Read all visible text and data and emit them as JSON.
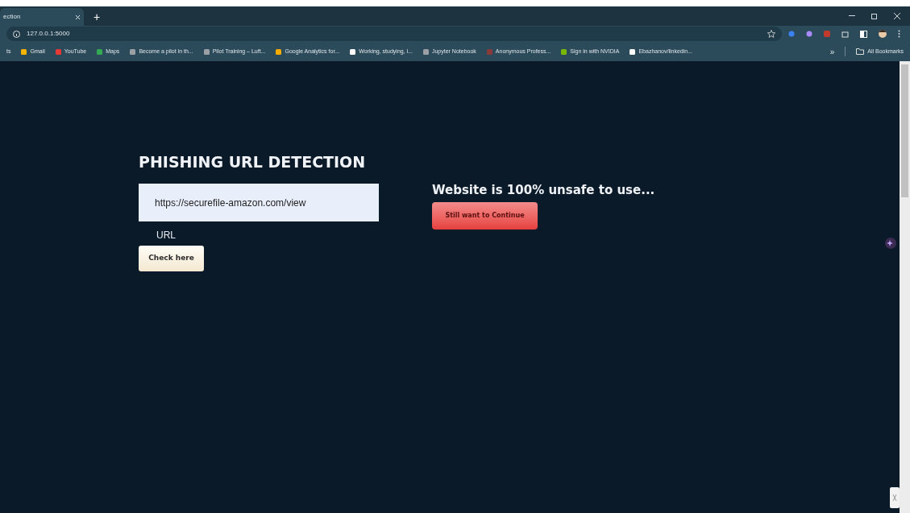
{
  "browser": {
    "tabs": [
      {
        "title": "ection",
        "selected": true
      }
    ],
    "address": "127.0.0.1:5000",
    "new_tab": "+",
    "bookmarks": [
      {
        "label": "ts"
      },
      {
        "label": "Gmail",
        "color": "#f4b400"
      },
      {
        "label": "YouTube",
        "color": "#e53935"
      },
      {
        "label": "Maps",
        "color": "#34a853"
      },
      {
        "label": "Become a pilot in th...",
        "color": "#9aa0a6"
      },
      {
        "label": "Pilot Training – Luft...",
        "color": "#9aa0a6"
      },
      {
        "label": "Google Analytics for...",
        "color": "#f9ab00"
      },
      {
        "label": "Working, studying, l...",
        "color": "#ffffff"
      },
      {
        "label": "Jupyter Notebook",
        "color": "#9aa0a6"
      },
      {
        "label": "Anonymous Profess...",
        "color": "#8b3a3a"
      },
      {
        "label": "Sign in with NVIDIA",
        "color": "#76b900"
      },
      {
        "label": "Ebazhanov/linkedin...",
        "color": "#ffffff"
      }
    ],
    "more": "»",
    "all_bookmarks": "All Bookmarks"
  },
  "page": {
    "title": "PHISHING URL DETECTION",
    "url_field": {
      "value": "https://securefile-amazon.com/view",
      "label": "URL"
    },
    "check_button": "Check here",
    "result": "Website is 100% unsafe to use...",
    "continue_button": "Still want to Continue"
  }
}
